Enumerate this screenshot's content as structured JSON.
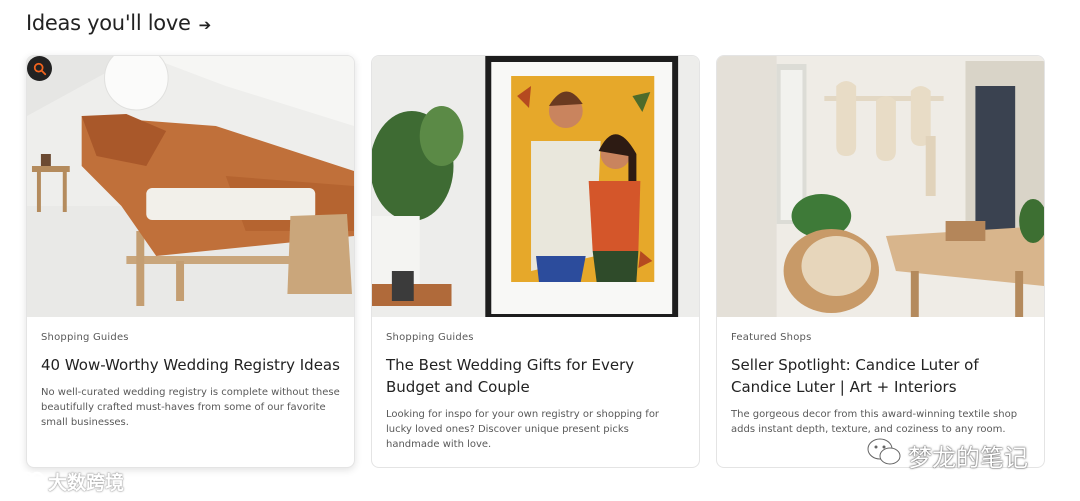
{
  "section": {
    "title": "Ideas you'll love",
    "arrow_icon": "arrow-right-icon"
  },
  "cards": [
    {
      "category": "Shopping Guides",
      "title": "40 Wow-Worthy Wedding Registry Ideas",
      "description": "No well-curated wedding registry is complete without these beautifully crafted must-haves from some of our favorite small businesses."
    },
    {
      "category": "Shopping Guides",
      "title": "The Best Wedding Gifts for Every Budget and Couple",
      "description": "Looking for inspo for your own registry or shopping for lucky loved ones? Discover unique present picks handmade with love."
    },
    {
      "category": "Featured Shops",
      "title": "Seller Spotlight: Candice Luter of Candice Luter | Art + Interiors",
      "description": "The gorgeous decor from this award-winning textile shop adds instant depth, texture, and coziness to any room."
    }
  ],
  "watermarks": {
    "left_text": "大数跨境",
    "right_text": "梦龙的笔记"
  },
  "colors": {
    "text_primary": "#222222",
    "text_secondary": "#595959",
    "border": "#e4e4e4"
  }
}
